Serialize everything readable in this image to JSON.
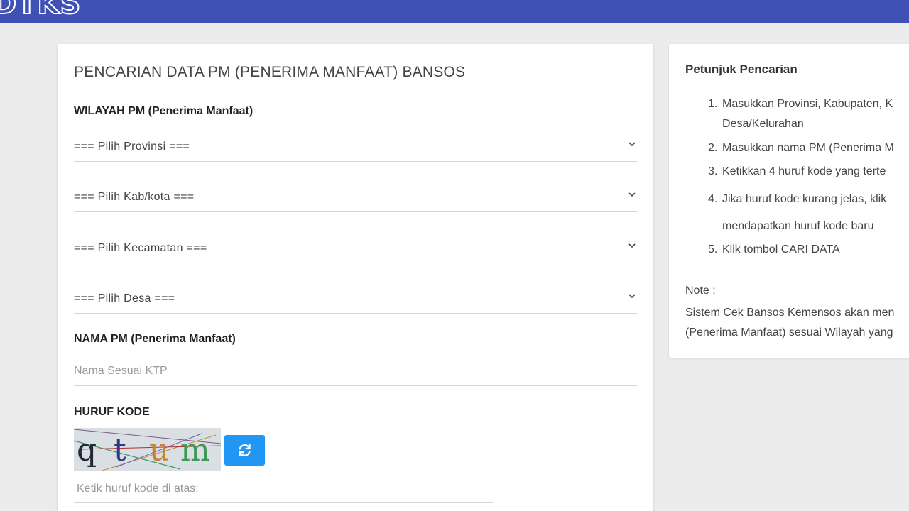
{
  "header": {
    "logo_text": "DTKS"
  },
  "form": {
    "title": "PENCARIAN DATA PM (PENERIMA MANFAAT) BANSOS",
    "wilayah_label": "WILAYAH PM (Penerima Manfaat)",
    "selects": {
      "provinsi": "=== Pilih Provinsi ===",
      "kabkota": "=== Pilih Kab/kota ===",
      "kecamatan": "=== Pilih Kecamatan ===",
      "desa": "=== Pilih Desa ==="
    },
    "nama_label": "NAMA PM (Penerima Manfaat)",
    "nama_placeholder": "Nama Sesuai KTP",
    "nama_value": "",
    "kode_label": "HURUF KODE",
    "captcha_text": "qtum",
    "captcha_placeholder": "Ketik huruf kode di atas:",
    "captcha_value": ""
  },
  "help": {
    "title": "Petunjuk Pencarian",
    "steps": {
      "s1_num": "1.",
      "s1_line1": "Masukkan Provinsi, Kabupaten, K",
      "s1_line2": "Desa/Kelurahan",
      "s2_num": "2.",
      "s2": "Masukkan nama PM (Penerima M",
      "s3_num": "3.",
      "s3": "Ketikkan 4 huruf kode yang terte",
      "s4_num": "4.",
      "s4_line1": "Jika huruf kode kurang jelas, klik",
      "s4_line2": "mendapatkan huruf kode baru",
      "s5_num": "5.",
      "s5": "Klik tombol CARI DATA"
    },
    "note_label": "Note :",
    "note_line1": "Sistem Cek Bansos Kemensos akan men",
    "note_line2": "(Penerima Manfaat) sesuai Wilayah yang"
  },
  "icons": {
    "chevron": "chevron-down-icon",
    "refresh": "refresh-icon"
  },
  "colors": {
    "header": "#3f51b5",
    "refresh_button": "#2196f3",
    "background": "#ececec"
  }
}
